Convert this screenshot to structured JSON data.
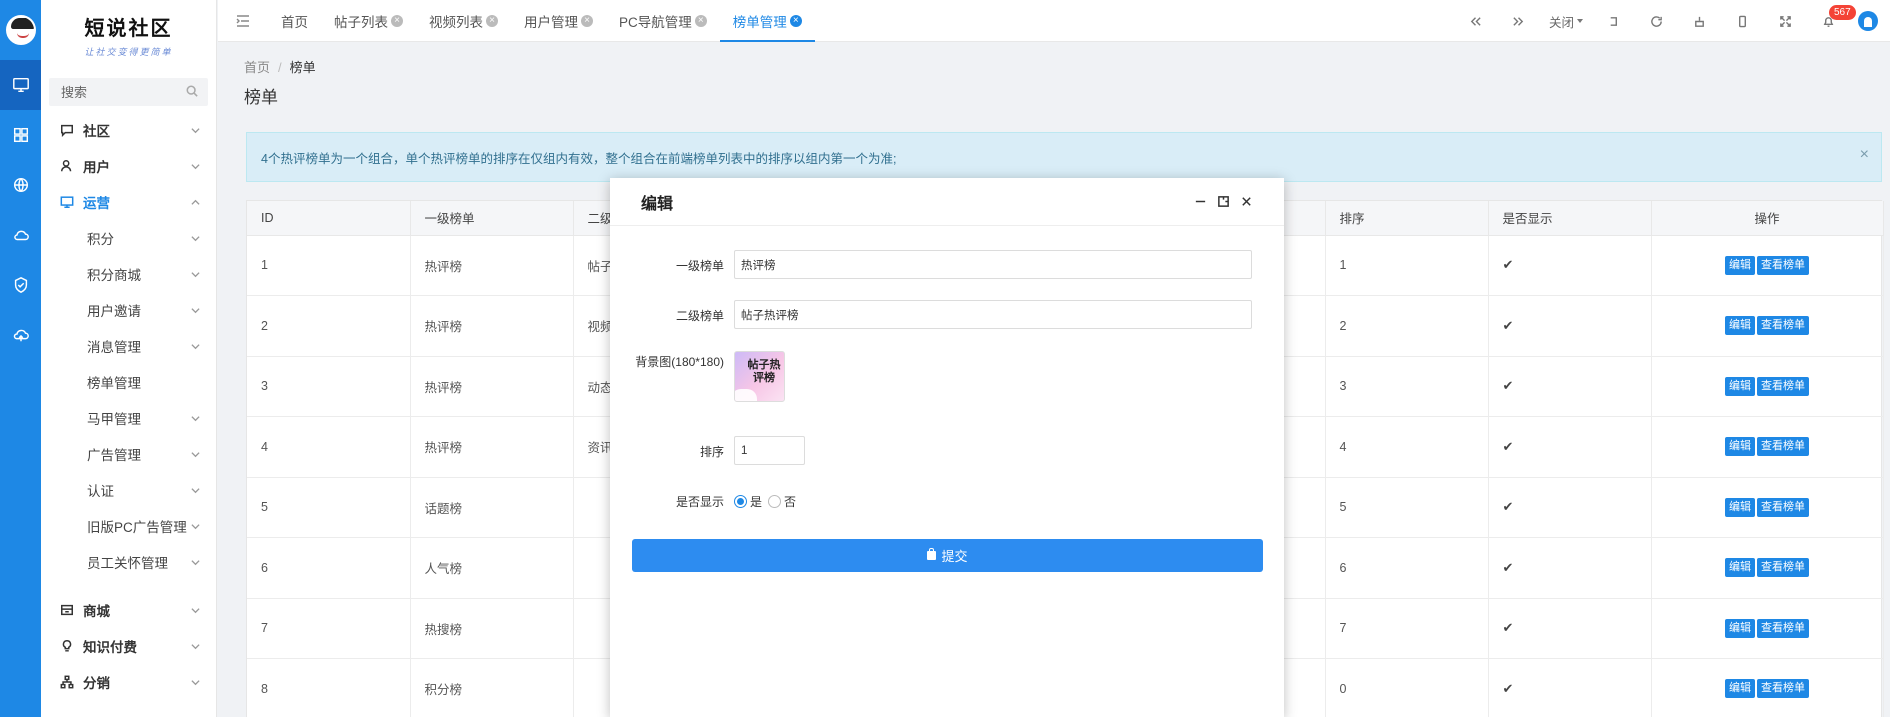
{
  "brand": {
    "title": "短说社区",
    "tagline": "让社交变得更简单"
  },
  "sidebar": {
    "search_placeholder": "搜索",
    "groups": [
      {
        "label": "社区",
        "icon": "chat-icon",
        "expanded": false
      },
      {
        "label": "用户",
        "icon": "user-icon",
        "expanded": false
      },
      {
        "label": "运营",
        "icon": "monitor-icon",
        "expanded": true,
        "active": true
      },
      {
        "label": "商城",
        "icon": "shop-icon",
        "expanded": false
      },
      {
        "label": "知识付费",
        "icon": "bulb-icon",
        "expanded": false
      },
      {
        "label": "分销",
        "icon": "network-icon",
        "expanded": false
      }
    ],
    "sub_items": [
      {
        "label": "积分",
        "has_children": true
      },
      {
        "label": "积分商城",
        "has_children": true
      },
      {
        "label": "用户邀请",
        "has_children": true
      },
      {
        "label": "消息管理",
        "has_children": true
      },
      {
        "label": "榜单管理",
        "has_children": false
      },
      {
        "label": "马甲管理",
        "has_children": true
      },
      {
        "label": "广告管理",
        "has_children": true
      },
      {
        "label": "认证",
        "has_children": true
      },
      {
        "label": "旧版PC广告管理",
        "has_children": true
      },
      {
        "label": "员工关怀管理",
        "has_children": true
      }
    ]
  },
  "tabs": [
    {
      "label": "首页",
      "closable": false
    },
    {
      "label": "帖子列表",
      "closable": true
    },
    {
      "label": "视频列表",
      "closable": true
    },
    {
      "label": "用户管理",
      "closable": true
    },
    {
      "label": "PC导航管理",
      "closable": true
    },
    {
      "label": "榜单管理",
      "closable": true,
      "active": true
    }
  ],
  "toolbar": {
    "close_label": "关闭",
    "notification_count": "567"
  },
  "breadcrumb": {
    "home": "首页",
    "separator": "/",
    "current": "榜单"
  },
  "page_title": "榜单",
  "alert": {
    "text": "4个热评榜单为一个组合，单个热评榜单的排序在仅组内有效，整个组合在前端榜单列表中的排序以组内第一个为准;",
    "close": "×"
  },
  "table": {
    "headers": [
      "ID",
      "一级榜单",
      "二级",
      "排序",
      "是否显示",
      "操作"
    ],
    "actions": {
      "edit": "编辑",
      "view": "查看榜单"
    },
    "check_glyph": "✔",
    "rows": [
      {
        "id": "1",
        "primary": "热评榜",
        "secondary": "帖子",
        "sort": "1"
      },
      {
        "id": "2",
        "primary": "热评榜",
        "secondary": "视频",
        "sort": "2"
      },
      {
        "id": "3",
        "primary": "热评榜",
        "secondary": "动态",
        "sort": "3"
      },
      {
        "id": "4",
        "primary": "热评榜",
        "secondary": "资讯",
        "sort": "4"
      },
      {
        "id": "5",
        "primary": "话题榜",
        "secondary": "",
        "sort": "5"
      },
      {
        "id": "6",
        "primary": "人气榜",
        "secondary": "",
        "sort": "6"
      },
      {
        "id": "7",
        "primary": "热搜榜",
        "secondary": "",
        "sort": "7"
      },
      {
        "id": "8",
        "primary": "积分榜",
        "secondary": "",
        "sort": "0"
      }
    ]
  },
  "modal": {
    "title": "编辑",
    "fields": {
      "primary_label": "一级榜单",
      "primary_value": "热评榜",
      "secondary_label": "二级榜单",
      "secondary_value": "帖子热评榜",
      "bg_label": "背景图(180*180)",
      "bg_thumb_text": "帖子热评榜",
      "sort_label": "排序",
      "sort_value": "1",
      "show_label": "是否显示",
      "show_yes": "是",
      "show_no": "否",
      "show_selected": "是"
    },
    "submit_label": "提交"
  },
  "colors": {
    "primary": "#1e88e5",
    "alert_bg": "#d9edf7",
    "badge": "#f44336"
  }
}
